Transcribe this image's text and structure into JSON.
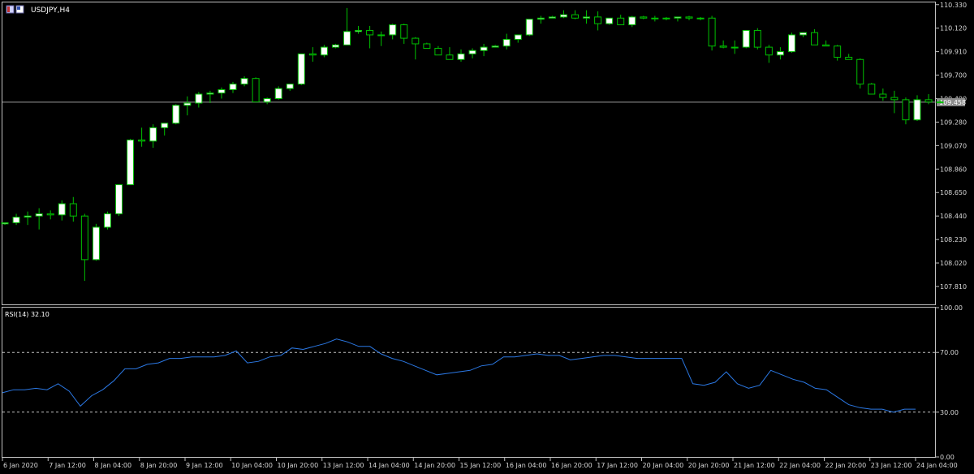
{
  "header": {
    "symbol_label": "USDJPY,H4"
  },
  "rsi_panel": {
    "label": "RSI(14) 32.10"
  },
  "price_tag": "109.458",
  "chart_data": [
    {
      "type": "candlestick",
      "symbol": "USDJPY",
      "timeframe": "H4",
      "ylim": [
        107.65,
        110.35
      ],
      "y_ticks": [
        "110.330",
        "110.120",
        "109.910",
        "109.700",
        "109.490",
        "109.280",
        "109.070",
        "108.860",
        "108.650",
        "108.440",
        "108.230",
        "108.020",
        "107.810"
      ],
      "current_price": 109.458,
      "colors": {
        "bull": "#ffffff",
        "bear": "#000000",
        "wick": "#00c000",
        "grid": "#c0c0c0"
      },
      "candles": [
        [
          108.37,
          108.38,
          108.36,
          108.38
        ],
        [
          108.38,
          108.46,
          108.36,
          108.43
        ],
        [
          108.43,
          108.48,
          108.36,
          108.44
        ],
        [
          108.44,
          108.51,
          108.32,
          108.46
        ],
        [
          108.46,
          108.49,
          108.41,
          108.45
        ],
        [
          108.45,
          108.58,
          108.4,
          108.55
        ],
        [
          108.55,
          108.61,
          108.39,
          108.44
        ],
        [
          108.44,
          108.46,
          107.86,
          108.05
        ],
        [
          108.05,
          108.37,
          108.04,
          108.34
        ],
        [
          108.34,
          108.48,
          108.32,
          108.46
        ],
        [
          108.46,
          108.71,
          108.44,
          108.72
        ],
        [
          108.72,
          109.13,
          108.72,
          109.12
        ],
        [
          109.12,
          109.23,
          109.06,
          109.11
        ],
        [
          109.11,
          109.26,
          109.05,
          109.23
        ],
        [
          109.23,
          109.27,
          109.16,
          109.27
        ],
        [
          109.27,
          109.44,
          109.26,
          109.43
        ],
        [
          109.43,
          109.51,
          109.34,
          109.45
        ],
        [
          109.45,
          109.55,
          109.41,
          109.53
        ],
        [
          109.53,
          109.56,
          109.45,
          109.54
        ],
        [
          109.54,
          109.59,
          109.49,
          109.57
        ],
        [
          109.57,
          109.64,
          109.54,
          109.62
        ],
        [
          109.62,
          109.69,
          109.6,
          109.67
        ],
        [
          109.67,
          109.68,
          109.46,
          109.46
        ],
        [
          109.46,
          109.5,
          109.44,
          109.49
        ],
        [
          109.49,
          109.6,
          109.48,
          109.58
        ],
        [
          109.58,
          109.62,
          109.56,
          109.62
        ],
        [
          109.62,
          109.89,
          109.61,
          109.89
        ],
        [
          109.89,
          109.95,
          109.82,
          109.88
        ],
        [
          109.88,
          109.97,
          109.86,
          109.95
        ],
        [
          109.95,
          109.98,
          109.94,
          109.97
        ],
        [
          109.97,
          110.3,
          109.97,
          110.09
        ],
        [
          110.09,
          110.14,
          110.07,
          110.1
        ],
        [
          110.1,
          110.14,
          109.94,
          110.06
        ],
        [
          110.06,
          110.09,
          109.96,
          110.06
        ],
        [
          110.06,
          110.16,
          110.02,
          110.15
        ],
        [
          110.15,
          110.16,
          109.98,
          110.03
        ],
        [
          110.03,
          110.04,
          109.84,
          109.98
        ],
        [
          109.98,
          109.99,
          109.94,
          109.94
        ],
        [
          109.94,
          109.96,
          109.9,
          109.88
        ],
        [
          109.88,
          109.95,
          109.85,
          109.84
        ],
        [
          109.84,
          109.93,
          109.82,
          109.89
        ],
        [
          109.89,
          109.94,
          109.85,
          109.92
        ],
        [
          109.92,
          109.98,
          109.87,
          109.95
        ],
        [
          109.95,
          109.97,
          109.95,
          109.96
        ],
        [
          109.96,
          110.07,
          109.93,
          110.02
        ],
        [
          110.02,
          110.05,
          109.99,
          110.06
        ],
        [
          110.06,
          110.2,
          110.05,
          110.2
        ],
        [
          110.2,
          110.23,
          110.16,
          110.21
        ],
        [
          110.21,
          110.23,
          110.21,
          110.22
        ],
        [
          110.22,
          110.28,
          110.21,
          110.24
        ],
        [
          110.24,
          110.28,
          110.2,
          110.21
        ],
        [
          110.21,
          110.28,
          110.16,
          110.22
        ],
        [
          110.22,
          110.27,
          110.1,
          110.16
        ],
        [
          110.16,
          110.19,
          110.15,
          110.21
        ],
        [
          110.21,
          110.24,
          110.16,
          110.15
        ],
        [
          110.15,
          110.23,
          110.13,
          110.22
        ],
        [
          110.22,
          110.23,
          110.2,
          110.21
        ],
        [
          110.21,
          110.23,
          110.18,
          110.21
        ],
        [
          110.21,
          110.22,
          110.19,
          110.21
        ],
        [
          110.21,
          110.22,
          110.18,
          110.22
        ],
        [
          110.22,
          110.23,
          110.19,
          110.21
        ],
        [
          110.21,
          110.22,
          110.19,
          110.21
        ],
        [
          110.21,
          110.23,
          109.92,
          109.96
        ],
        [
          109.96,
          110.01,
          109.94,
          109.95
        ],
        [
          109.95,
          110.01,
          109.89,
          109.95
        ],
        [
          109.95,
          110.09,
          109.94,
          110.1
        ],
        [
          110.1,
          110.12,
          109.93,
          109.95
        ],
        [
          109.95,
          109.97,
          109.81,
          109.88
        ],
        [
          109.88,
          109.95,
          109.84,
          109.91
        ],
        [
          109.91,
          110.08,
          109.9,
          110.06
        ],
        [
          110.06,
          110.08,
          110.04,
          110.08
        ],
        [
          110.08,
          110.11,
          109.98,
          109.97
        ],
        [
          109.97,
          110.01,
          109.96,
          109.96
        ],
        [
          109.96,
          109.97,
          109.83,
          109.86
        ],
        [
          109.86,
          109.89,
          109.84,
          109.84
        ],
        [
          109.84,
          109.85,
          109.58,
          109.62
        ],
        [
          109.62,
          109.63,
          109.54,
          109.53
        ],
        [
          109.53,
          109.58,
          109.47,
          109.5
        ],
        [
          109.5,
          109.56,
          109.36,
          109.48
        ],
        [
          109.48,
          109.5,
          109.26,
          109.3
        ],
        [
          109.3,
          109.52,
          109.29,
          109.48
        ],
        [
          109.48,
          109.53,
          109.44,
          109.46
        ],
        [
          109.46,
          109.48,
          109.45,
          109.458
        ]
      ]
    },
    {
      "type": "line",
      "name": "RSI(14)",
      "ylim": [
        0,
        100
      ],
      "y_ticks": [
        "100.00",
        "70.00",
        "30.00",
        "0.00"
      ],
      "levels": [
        70,
        30
      ],
      "color": "#2b78e4",
      "values": [
        43,
        45,
        45,
        46,
        45,
        49,
        44,
        34,
        41,
        45,
        51,
        59,
        59,
        62,
        63,
        66,
        66,
        67,
        67,
        67,
        68,
        71,
        63,
        64,
        67,
        68,
        73,
        72,
        74,
        76,
        79,
        77,
        74,
        74,
        69,
        66,
        64,
        61,
        58,
        55,
        56,
        57,
        58,
        61,
        62,
        67,
        67,
        68,
        69,
        68,
        68,
        65,
        66,
        67,
        68,
        68,
        67,
        66,
        66,
        66,
        66,
        66,
        49,
        48,
        50,
        57,
        49,
        46,
        48,
        58,
        55,
        52,
        50,
        46,
        45,
        40,
        35,
        33,
        32,
        32,
        30,
        32,
        32
      ]
    }
  ],
  "time_axis": [
    "6 Jan 2020",
    "7 Jan 12:00",
    "8 Jan 04:00",
    "8 Jan 20:00",
    "9 Jan 12:00",
    "10 Jan 04:00",
    "10 Jan 20:00",
    "13 Jan 12:00",
    "14 Jan 04:00",
    "14 Jan 20:00",
    "15 Jan 12:00",
    "16 Jan 04:00",
    "16 Jan 20:00",
    "17 Jan 12:00",
    "20 Jan 04:00",
    "20 Jan 20:00",
    "21 Jan 12:00",
    "22 Jan 04:00",
    "22 Jan 20:00",
    "23 Jan 12:00",
    "24 Jan 04:00"
  ]
}
